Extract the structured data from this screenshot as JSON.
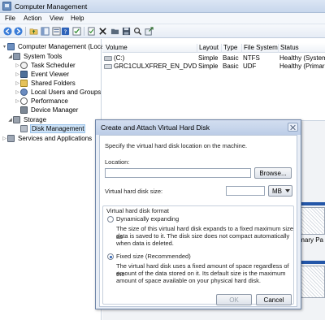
{
  "window": {
    "title": "Computer Management"
  },
  "menu": [
    "File",
    "Action",
    "View",
    "Help"
  ],
  "toolbar": {
    "icons": [
      "back-icon",
      "forward-icon",
      "up-folder-icon",
      "show-tree-icon",
      "help-icon",
      "properties-icon",
      "checklist-icon",
      "delete-icon",
      "open-folder-icon",
      "save-icon",
      "search-icon",
      "export-icon"
    ]
  },
  "tree": {
    "items": [
      {
        "label": "Computer Management (Local",
        "icon": "computer-icon",
        "arrow": "▾"
      },
      {
        "label": "System Tools",
        "icon": "tools-icon",
        "arrow": "◢"
      },
      {
        "label": "Task Scheduler",
        "icon": "clock-icon",
        "arrow": "▷"
      },
      {
        "label": "Event Viewer",
        "icon": "event-viewer-icon",
        "arrow": "▷"
      },
      {
        "label": "Shared Folders",
        "icon": "shared-folder-icon",
        "arrow": "▷"
      },
      {
        "label": "Local Users and Groups",
        "icon": "users-icon",
        "arrow": "▷"
      },
      {
        "label": "Performance",
        "icon": "performance-icon",
        "arrow": "▷"
      },
      {
        "label": "Device Manager",
        "icon": "device-manager-icon",
        "arrow": ""
      },
      {
        "label": "Storage",
        "icon": "storage-icon",
        "arrow": "◢"
      },
      {
        "label": "Disk Management",
        "icon": "disk-management-icon",
        "arrow": ""
      },
      {
        "label": "Services and Applications",
        "icon": "services-icon",
        "arrow": "▷"
      }
    ],
    "selected": "Disk Management"
  },
  "volumes": {
    "headers": [
      "Volume",
      "Layout",
      "Type",
      "File System",
      "Status"
    ],
    "rows": [
      [
        "(C:)",
        "Simple",
        "Basic",
        "NTFS",
        "Healthy (System"
      ],
      [
        "GRC1CULXFRER_EN_DVD (D:)",
        "Simple",
        "Basic",
        "UDF",
        "Healthy (Primar"
      ]
    ]
  },
  "disk_area": {
    "partial_text": "np, Primary Pa"
  },
  "dialog": {
    "title": "Create and Attach Virtual Hard Disk",
    "instruction": "Specify the virtual hard disk location on the machine.",
    "location_label": "Location:",
    "location_value": "",
    "browse_label": "Browse...",
    "size_label": "Virtual hard disk size:",
    "size_value": "",
    "size_unit": "MB",
    "format_label": "Virtual hard disk format",
    "dynamic_label": "Dynamically expanding",
    "dynamic_desc_1": "The size of this virtual hard disk expands to a fixed maximum size as",
    "dynamic_desc_2": "data is saved to it.  The disk size does not compact automatically",
    "dynamic_desc_3": "when data is deleted.",
    "fixed_label": "Fixed size (Recommended)",
    "fixed_desc_1": "The virtual hard disk uses a fixed amount of space regardless of the",
    "fixed_desc_2": "amount of the data stored on it. Its default size is the maximum",
    "fixed_desc_3": "amount of space available on your physical hard disk.",
    "selected_format": "fixed",
    "ok_label": "OK",
    "cancel_label": "Cancel"
  }
}
